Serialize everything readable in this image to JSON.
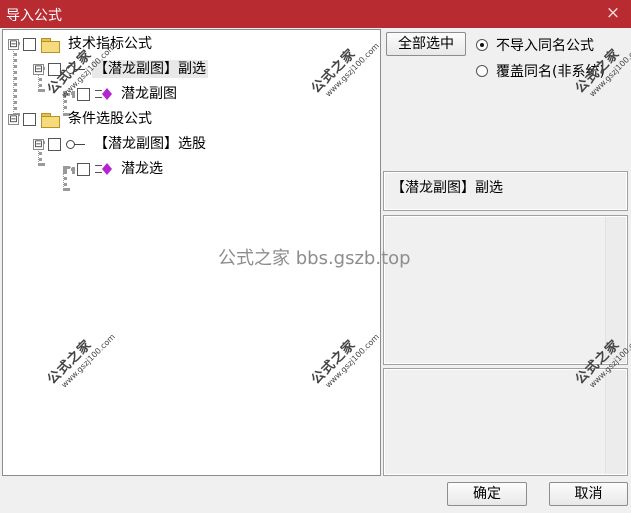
{
  "window": {
    "title": "导入公式",
    "close_label": "×"
  },
  "tree": {
    "expander_open": "⊟",
    "nodes": [
      {
        "label": "技术指标公式"
      },
      {
        "label": "【潜龙副图】副选"
      },
      {
        "label": "潜龙副图"
      },
      {
        "label": "条件选股公式"
      },
      {
        "label": "【潜龙副图】选股"
      },
      {
        "label": "潜龙选"
      }
    ]
  },
  "options": {
    "select_all_label": "全部选中",
    "radio_skip_label": "不导入同名公式",
    "radio_overwrite_label": "覆盖同名(非系统)",
    "selected_radio": "不导入同名公式"
  },
  "details": {
    "formula_name": "【潜龙副图】副选"
  },
  "footer": {
    "ok_label": "确定",
    "cancel_label": "取消"
  },
  "watermarks": {
    "center": "公式之家 bbs.gszb.top",
    "stamp_text": "公式之家",
    "stamp_url": "www.gszj100.com"
  }
}
